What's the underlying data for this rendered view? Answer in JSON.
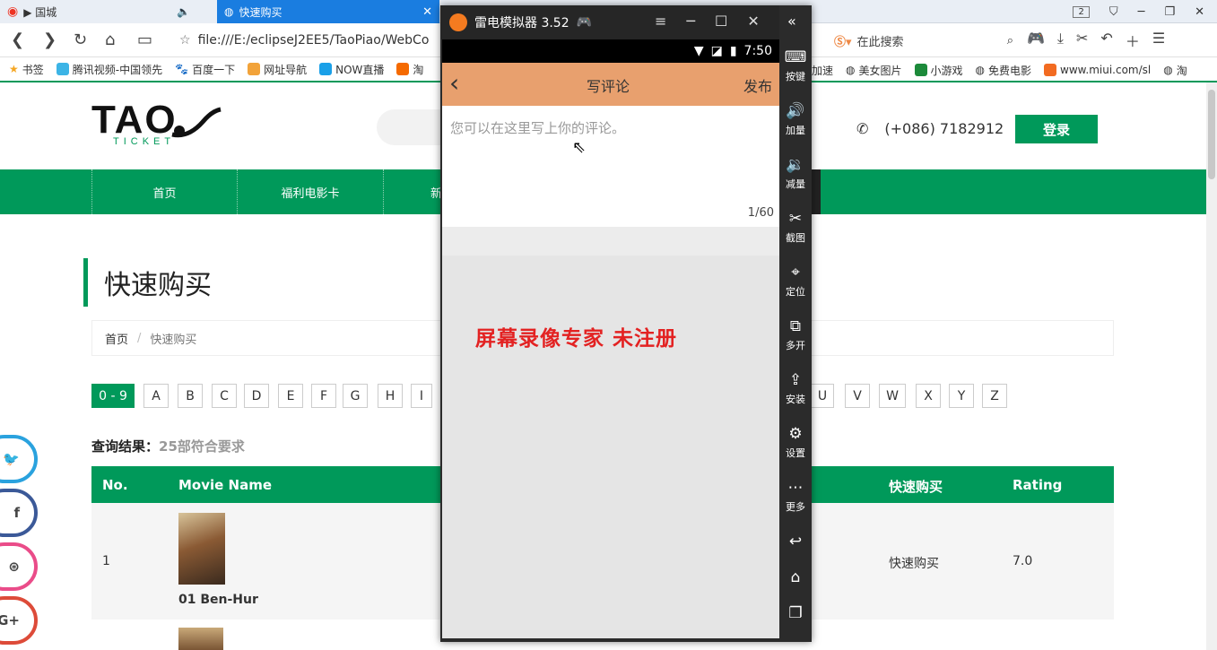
{
  "browser": {
    "tabs": [
      {
        "label": "▶ 国城"
      },
      {
        "label": "快速购买"
      }
    ],
    "tab_count": "2",
    "url": "file:///E:/eclipseJ2EE5/TaoPiao/WebCo",
    "search_placeholder": "在此搜索",
    "bookmarks": [
      "书签",
      "腾讯视频-中国领先",
      "百度一下",
      "网址导航",
      "NOW直播",
      "淘",
      "加速",
      "美女图片",
      "小游戏",
      "免费电影",
      "www.miui.com/sl",
      "淘"
    ]
  },
  "site": {
    "logo_main": "TAO",
    "logo_sub": "TICKET",
    "phone": "(+086) 7182912",
    "login": "登录",
    "nav": [
      "首页",
      "福利电影卡",
      "新"
    ],
    "page_title": "快速购买",
    "breadcrumb": {
      "home": "首页",
      "sep": "/",
      "current": "快速购买"
    },
    "letters_left": [
      "0 - 9",
      "A",
      "B",
      "C",
      "D",
      "E",
      "F",
      "G",
      "H",
      "I"
    ],
    "letters_right": [
      "U",
      "V",
      "W",
      "X",
      "Y",
      "Z"
    ],
    "result_label": "查询结果：",
    "result_count": "25部符合要求",
    "table": {
      "headers": {
        "no": "No.",
        "name": "Movie Name",
        "buy": "快速购买",
        "rating": "Rating"
      },
      "rows": [
        {
          "no": "1",
          "name": "01 Ben-Hur",
          "buy": "快速购买",
          "rating": "7.0"
        }
      ]
    },
    "social": [
      "twitter-icon",
      "facebook-icon",
      "dribbble-icon",
      "google-plus-icon"
    ]
  },
  "emulator": {
    "title": "雷电模拟器 3.52",
    "time": "7:50",
    "app": {
      "back": "‹",
      "title": "写评论",
      "publish": "发布",
      "placeholder": "您可以在这里写上你的评论。",
      "counter": "1/60"
    },
    "watermark": "屏幕录像专家  未注册",
    "sidebar": [
      "按键",
      "加量",
      "减量",
      "截图",
      "定位",
      "多开",
      "安装",
      "设置",
      "更多"
    ]
  }
}
